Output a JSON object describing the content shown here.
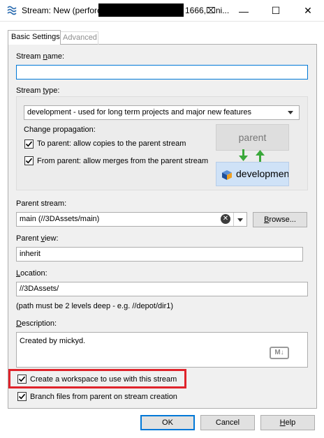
{
  "window": {
    "title_prefix": "Stream: New (perforc",
    "title_suffix": "1666,⌧ni...",
    "minimize": "—",
    "maximize": "☐",
    "close": "✕"
  },
  "tabs": [
    {
      "label": "Basic Settings",
      "active": true
    },
    {
      "label": "Advanced",
      "active": false
    }
  ],
  "form": {
    "stream_name_label": "Stream name:",
    "stream_name_value": "",
    "stream_type_label": "Stream type:",
    "stream_type_value": "development - used for long term projects and major new features",
    "change_propagation_label": "Change propagation:",
    "to_parent_label": "To parent: allow copies to the parent stream",
    "to_parent_checked": true,
    "from_parent_label": "From parent: allow merges from the parent stream",
    "from_parent_checked": true,
    "diagram_parent": "parent",
    "diagram_child": "developmen",
    "parent_stream_label": "Parent stream:",
    "parent_stream_value": "main (//3DAssets/main)",
    "browse_label": "Browse...",
    "parent_view_label": "Parent view:",
    "parent_view_value": "inherit",
    "location_label": "Location:",
    "location_value": "//3DAssets/",
    "location_hint": "(path must be 2 levels deep - e.g. //depot/dir1)",
    "description_label": "Description:",
    "description_value": "Created by mickyd.",
    "markdown_badge": "M↓",
    "create_workspace_label": "Create a workspace to use with this stream",
    "create_workspace_checked": true,
    "branch_files_label": "Branch files from parent on stream creation",
    "branch_files_checked": true
  },
  "buttons": {
    "ok": "OK",
    "cancel": "Cancel",
    "help": "Help"
  },
  "colors": {
    "accent": "#0078d7",
    "highlight": "#e0232b",
    "dev_box": "#cfe2f7",
    "arrow_green": "#3aa83a"
  }
}
